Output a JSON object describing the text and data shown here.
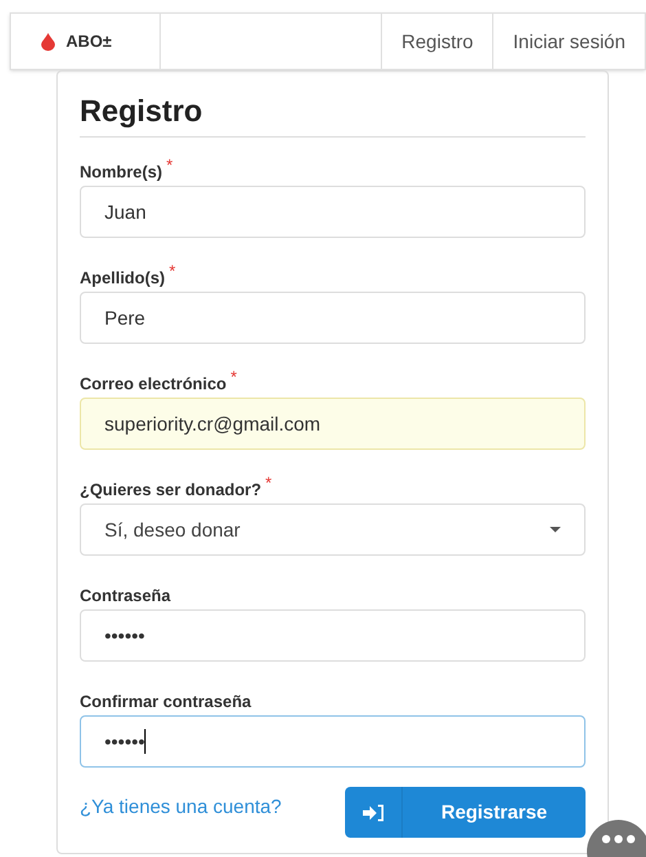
{
  "navbar": {
    "brand": "ABO±",
    "links": [
      {
        "label": "Registro",
        "selected": false
      },
      {
        "label": "Iniciar sesión",
        "selected": false
      }
    ]
  },
  "form": {
    "title": "Registro",
    "fields": [
      {
        "kind": "text",
        "label": "Nombre(s)",
        "required_mark": "*",
        "value": "Juan",
        "autofilled": false,
        "focused": false
      },
      {
        "kind": "text",
        "label": "Apellido(s)",
        "required_mark": "*",
        "value": "Pere",
        "autofilled": false,
        "focused": false
      },
      {
        "kind": "text",
        "label": "Correo electrónico",
        "required_mark": "*",
        "value": "superiority.cr@gmail.com",
        "autofilled": true,
        "focused": false
      },
      {
        "kind": "select",
        "label": "¿Quieres ser donador?",
        "required_mark": "*",
        "value": "Sí, deseo donar",
        "autofilled": false,
        "focused": false
      },
      {
        "kind": "password",
        "label": "Contraseña",
        "value": "••••••",
        "autofilled": false,
        "focused": false
      },
      {
        "kind": "password",
        "label": "Confirmar contraseña",
        "value": "••••••",
        "autofilled": false,
        "focused": true
      }
    ],
    "login_link": "¿Ya tienes una cuenta?",
    "submit": "Registrarse"
  }
}
